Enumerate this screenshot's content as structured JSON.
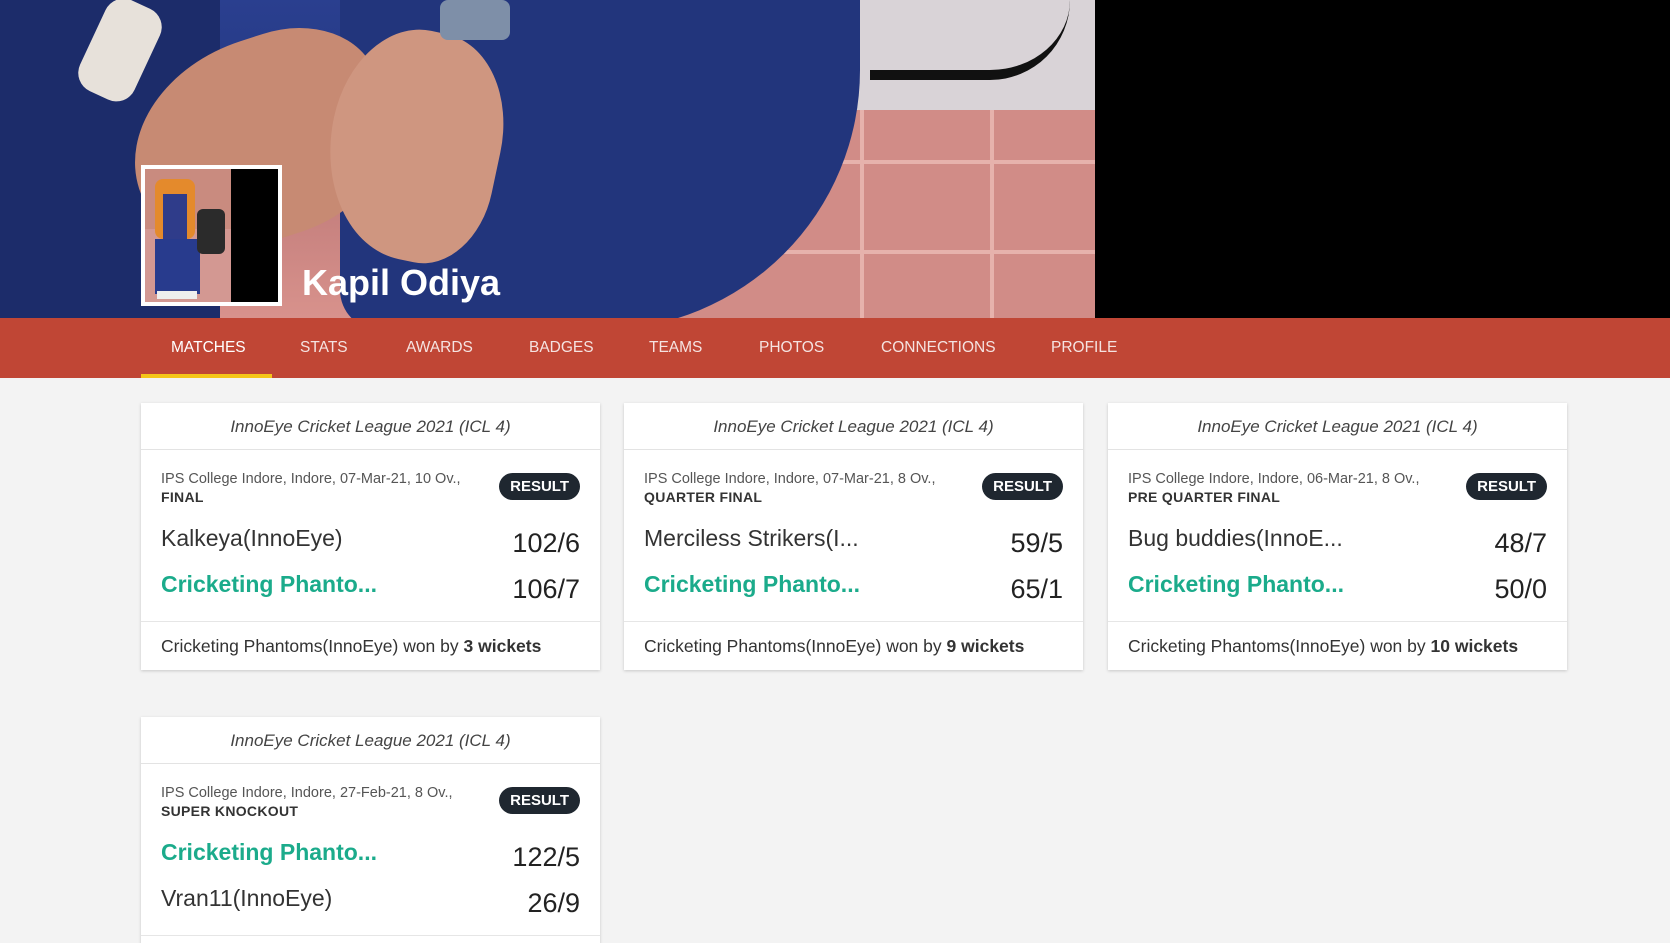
{
  "profile": {
    "name": "Kapil Odiya"
  },
  "nav": {
    "tabs": [
      {
        "label": "MATCHES"
      },
      {
        "label": "STATS"
      },
      {
        "label": "AWARDS"
      },
      {
        "label": "BADGES"
      },
      {
        "label": "TEAMS"
      },
      {
        "label": "PHOTOS"
      },
      {
        "label": "CONNECTIONS"
      },
      {
        "label": "PROFILE"
      }
    ],
    "active": "MATCHES"
  },
  "colors": {
    "nav_bg": "#c04635",
    "active_underline": "#f5c518",
    "winner_text": "#1bab8b",
    "badge_bg": "#1f2730"
  },
  "matches": [
    {
      "league": "InnoEye Cricket League 2021 (ICL 4)",
      "meta": "IPS College Indore, Indore, 07-Mar-21, 10 Ov.,",
      "stage": "FINAL",
      "badge": "RESULT",
      "team1": {
        "name": "Kalkeya(InnoEye)",
        "score": "102/6"
      },
      "team2": {
        "name": "Cricketing Phanto...",
        "score": "106/7"
      },
      "result_team": "Cricketing Phantoms(InnoEye)",
      "result_mid": " won by ",
      "result_margin": "3 wickets"
    },
    {
      "league": "InnoEye Cricket League 2021 (ICL 4)",
      "meta": "IPS College Indore, Indore, 07-Mar-21, 8 Ov.,",
      "stage": "QUARTER FINAL",
      "badge": "RESULT",
      "team1": {
        "name": "Merciless Strikers(I...",
        "score": "59/5"
      },
      "team2": {
        "name": "Cricketing Phanto...",
        "score": "65/1"
      },
      "result_team": "Cricketing Phantoms(InnoEye)",
      "result_mid": " won by ",
      "result_margin": "9 wickets"
    },
    {
      "league": "InnoEye Cricket League 2021 (ICL 4)",
      "meta": "IPS College Indore, Indore, 06-Mar-21, 8 Ov.,",
      "stage": "PRE QUARTER FINAL",
      "badge": "RESULT",
      "team1": {
        "name": "Bug buddies(InnoE...",
        "score": "48/7"
      },
      "team2": {
        "name": "Cricketing Phanto...",
        "score": "50/0"
      },
      "result_team": "Cricketing Phantoms(InnoEye)",
      "result_mid": " won by ",
      "result_margin": "10 wickets"
    },
    {
      "league": "InnoEye Cricket League 2021 (ICL 4)",
      "meta": "IPS College Indore, Indore, 27-Feb-21, 8 Ov.,",
      "stage": "SUPER KNOCKOUT",
      "badge": "RESULT",
      "team1": {
        "name": "Cricketing Phanto...",
        "score": "122/5"
      },
      "team2": {
        "name": "Vran11(InnoEye)",
        "score": "26/9"
      }
    }
  ]
}
